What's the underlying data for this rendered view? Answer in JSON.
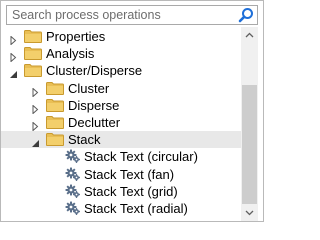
{
  "search": {
    "placeholder": "Search process operations",
    "icon": "search-icon"
  },
  "tree": {
    "items": [
      {
        "label": "Properties",
        "level": 0,
        "state": "collapsed",
        "icon": "folder-icon"
      },
      {
        "label": "Analysis",
        "level": 0,
        "state": "collapsed",
        "icon": "folder-icon"
      },
      {
        "label": "Cluster/Disperse",
        "level": 0,
        "state": "expanded",
        "icon": "folder-icon"
      },
      {
        "label": "Cluster",
        "level": 1,
        "state": "collapsed",
        "icon": "folder-icon"
      },
      {
        "label": "Disperse",
        "level": 1,
        "state": "collapsed",
        "icon": "folder-icon"
      },
      {
        "label": "Declutter",
        "level": 1,
        "state": "collapsed",
        "icon": "folder-icon"
      },
      {
        "label": "Stack",
        "level": 1,
        "state": "expanded",
        "icon": "folder-icon",
        "selected": true
      },
      {
        "label": "Stack Text (circular)",
        "level": 2,
        "state": "leaf",
        "icon": "gear-icon"
      },
      {
        "label": "Stack Text (fan)",
        "level": 2,
        "state": "leaf",
        "icon": "gear-icon"
      },
      {
        "label": "Stack Text (grid)",
        "level": 2,
        "state": "leaf",
        "icon": "gear-icon"
      },
      {
        "label": "Stack Text (radial)",
        "level": 2,
        "state": "leaf",
        "icon": "gear-icon"
      }
    ]
  },
  "colors": {
    "folder": "#e9bf55",
    "selection": "#e8e8e8",
    "search_icon": "#1e6fd9",
    "gear": "#5a6f8a"
  }
}
